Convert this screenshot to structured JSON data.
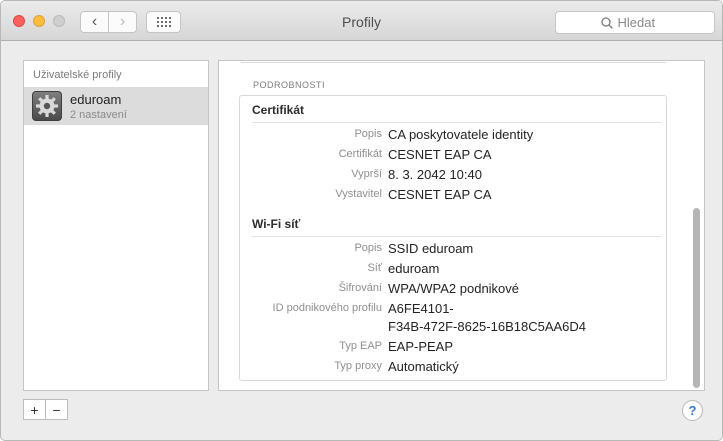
{
  "window": {
    "title": "Profily"
  },
  "toolbar": {
    "back_symbol": "‹",
    "forward_symbol": "›"
  },
  "search": {
    "placeholder": "Hledat"
  },
  "sidebar": {
    "header": "Uživatelské profily",
    "items": [
      {
        "name": "eduroam",
        "subtitle": "2 nastavení",
        "icon": "settings-gear-icon"
      }
    ],
    "add_label": "+",
    "remove_label": "−"
  },
  "details": {
    "section_label": "PODROBNOSTI",
    "certificate": {
      "title": "Certifikát",
      "rows": [
        {
          "label": "Popis",
          "value": "CA poskytovatele identity"
        },
        {
          "label": "Certifikát",
          "value": "CESNET EAP CA"
        },
        {
          "label": "Vyprší",
          "value": "8. 3. 2042 10:40"
        },
        {
          "label": "Vystavitel",
          "value": "CESNET EAP CA"
        }
      ]
    },
    "wifi": {
      "title": "Wi-Fi síť",
      "rows": [
        {
          "label": "Popis",
          "value": "SSID eduroam"
        },
        {
          "label": "Síť",
          "value": "eduroam"
        },
        {
          "label": "Šifrování",
          "value": "WPA/WPA2 podnikové"
        },
        {
          "label": "ID podnikového profilu",
          "value": "A6FE4101-",
          "value2": "F34B-472F-8625-16B18C5AA6D4"
        },
        {
          "label": "Typ EAP",
          "value": "EAP-PEAP"
        },
        {
          "label": "Typ proxy",
          "value": "Automatický"
        }
      ]
    }
  },
  "help": {
    "label": "?"
  }
}
